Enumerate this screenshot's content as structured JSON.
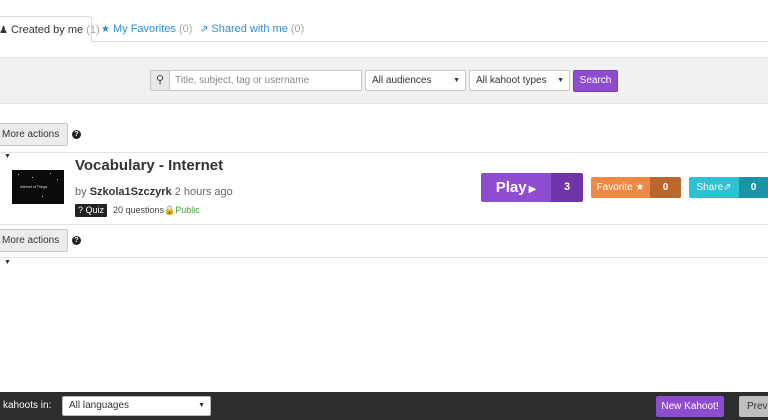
{
  "tabs": [
    {
      "label": "Created by me",
      "count": "(1)",
      "icon": "user-icon"
    },
    {
      "label": "My Favorites",
      "count": "(0)",
      "icon": "star-icon"
    },
    {
      "label": "Shared with me",
      "count": "(0)",
      "icon": "share-icon"
    }
  ],
  "filters": {
    "search_placeholder": "Title, subject, tag or username",
    "audience": "All audiences",
    "type": "All kahoot types",
    "search_label": "Search"
  },
  "more_actions_label": "More actions",
  "help_glyph": "?",
  "kahoot": {
    "title": "Vocabulary - Internet",
    "by": "by",
    "author": "Szkola1Szczyrk",
    "time": "2 hours ago",
    "badge": "Quiz",
    "badge_glyph": "?",
    "questions": "20 questions",
    "visibility": "Public",
    "thumbnail_text": "Internet of Things",
    "play_label": "Play",
    "play_count": "3",
    "favorite_label": "Favorite",
    "favorite_count": "0",
    "share_label": "Share",
    "share_count": "0"
  },
  "footer": {
    "label": "kahoots in:",
    "language": "All languages",
    "new_label": "New Kahoot!",
    "prev_label": "Prev"
  },
  "colors": {
    "purple": "#8e4ccf",
    "orange": "#ec8a45",
    "teal": "#2fc0d2",
    "link_blue": "#2a8fd8",
    "public_green": "#43a142"
  }
}
